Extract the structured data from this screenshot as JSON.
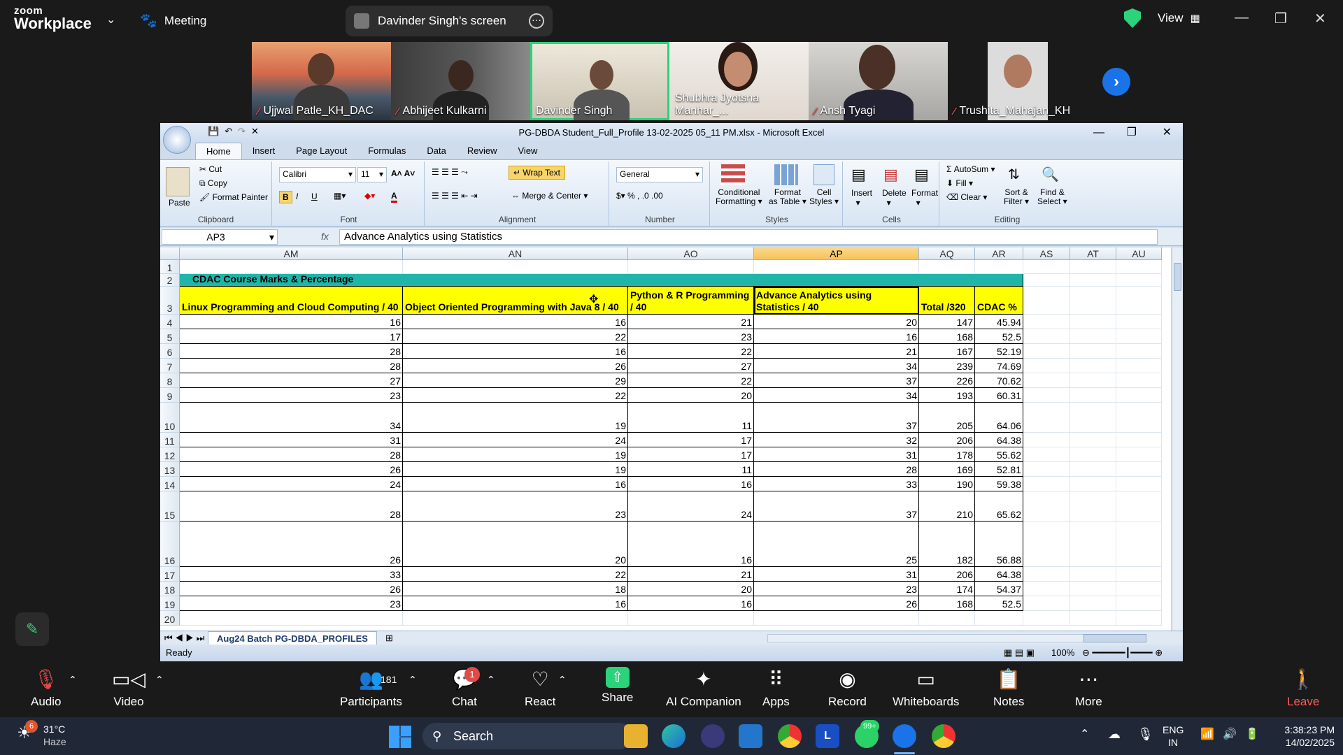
{
  "zoom": {
    "brand_top": "zoom",
    "brand_bottom": "Workplace",
    "meeting_label": "Meeting",
    "screen_share_label": "Davinder Singh's screen",
    "view_label": "View",
    "participants": [
      {
        "name": "Ujjwal Patle_KH_DAC",
        "muted": true
      },
      {
        "name": "Abhijeet Kulkarni",
        "muted": true
      },
      {
        "name": "Davinder Singh",
        "muted": false,
        "active": true
      },
      {
        "name": "Shubhra Jyotsna Manhar_...",
        "muted": false
      },
      {
        "name": "Ansh Tyagi",
        "muted": true
      },
      {
        "name": "Trushita_Mahajan_KH",
        "muted": true
      }
    ],
    "toolbar": {
      "audio": "Audio",
      "video": "Video",
      "participants": "Participants",
      "participants_count": "181",
      "chat": "Chat",
      "chat_badge": "1",
      "react": "React",
      "share": "Share",
      "ai_companion": "AI Companion",
      "apps": "Apps",
      "record": "Record",
      "whiteboards": "Whiteboards",
      "notes": "Notes",
      "more": "More",
      "leave": "Leave"
    }
  },
  "excel": {
    "title": "PG-DBDA Student_Full_Profile 13-02-2025 05_11 PM.xlsx - Microsoft Excel",
    "tabs": [
      "Home",
      "Insert",
      "Page Layout",
      "Formulas",
      "Data",
      "Review",
      "View"
    ],
    "ribbon": {
      "clipboard": {
        "label": "Clipboard",
        "paste": "Paste",
        "cut": "Cut",
        "copy": "Copy",
        "format_painter": "Format Painter"
      },
      "font": {
        "label": "Font",
        "name": "Calibri",
        "size": "11"
      },
      "alignment": {
        "label": "Alignment",
        "wrap_text": "Wrap Text",
        "merge_center": "Merge & Center"
      },
      "number": {
        "label": "Number",
        "format": "General"
      },
      "styles": {
        "label": "Styles",
        "conditional": "Conditional Formatting",
        "format_table": "Format as Table",
        "cell_styles": "Cell Styles"
      },
      "cells": {
        "label": "Cells",
        "insert": "Insert",
        "delete": "Delete",
        "format": "Format"
      },
      "editing": {
        "label": "Editing",
        "autosum": "AutoSum",
        "fill": "Fill",
        "clear": "Clear",
        "sort_filter": "Sort & Filter",
        "find_select": "Find & Select"
      }
    },
    "name_box": "AP3",
    "formula": "Advance Analytics using Statistics",
    "columns": [
      "AM",
      "AN",
      "AO",
      "AP",
      "AQ",
      "AR",
      "AS",
      "AT",
      "AU"
    ],
    "banner": "CDAC Course Marks & Percentage",
    "headers": [
      "Linux Programming and Cloud Computing / 40",
      "Object Oriented Programming with Java 8 / 40",
      "Python & R Programming / 40",
      "Advance Analytics using Statistics / 40",
      "Total /320",
      "CDAC %"
    ],
    "rows": [
      {
        "n": "4",
        "v": [
          "16",
          "16",
          "21",
          "20",
          "147",
          "45.94"
        ]
      },
      {
        "n": "5",
        "v": [
          "17",
          "22",
          "23",
          "16",
          "168",
          "52.5"
        ]
      },
      {
        "n": "6",
        "v": [
          "28",
          "16",
          "22",
          "21",
          "167",
          "52.19"
        ]
      },
      {
        "n": "7",
        "v": [
          "28",
          "26",
          "27",
          "34",
          "239",
          "74.69"
        ]
      },
      {
        "n": "8",
        "v": [
          "27",
          "29",
          "22",
          "37",
          "226",
          "70.62"
        ]
      },
      {
        "n": "9",
        "v": [
          "23",
          "22",
          "20",
          "34",
          "193",
          "60.31"
        ]
      },
      {
        "n": "10",
        "v": [
          "34",
          "19",
          "11",
          "37",
          "205",
          "64.06"
        ]
      },
      {
        "n": "11",
        "v": [
          "31",
          "24",
          "17",
          "32",
          "206",
          "64.38"
        ]
      },
      {
        "n": "12",
        "v": [
          "28",
          "19",
          "17",
          "31",
          "178",
          "55.62"
        ]
      },
      {
        "n": "13",
        "v": [
          "26",
          "19",
          "11",
          "28",
          "169",
          "52.81"
        ]
      },
      {
        "n": "14",
        "v": [
          "24",
          "16",
          "16",
          "33",
          "190",
          "59.38"
        ]
      },
      {
        "n": "15",
        "v": [
          "28",
          "23",
          "24",
          "37",
          "210",
          "65.62"
        ]
      },
      {
        "n": "16",
        "v": [
          "26",
          "20",
          "16",
          "25",
          "182",
          "56.88"
        ]
      },
      {
        "n": "17",
        "v": [
          "33",
          "22",
          "21",
          "31",
          "206",
          "64.38"
        ]
      },
      {
        "n": "18",
        "v": [
          "26",
          "18",
          "20",
          "23",
          "174",
          "54.37"
        ]
      },
      {
        "n": "19",
        "v": [
          "23",
          "16",
          "16",
          "26",
          "168",
          "52.5"
        ]
      }
    ],
    "sheet_tab": "Aug24 Batch PG-DBDA_PROFILES",
    "status": "Ready",
    "zoom_level": "100%"
  },
  "taskbar": {
    "weather_temp": "31°C",
    "weather_desc": "Haze",
    "weather_badge": "6",
    "search": "Search",
    "lang_top": "ENG",
    "lang_bottom": "IN",
    "time": "3:38:23 PM",
    "date": "14/02/2025",
    "whatsapp_badge": "99+"
  }
}
